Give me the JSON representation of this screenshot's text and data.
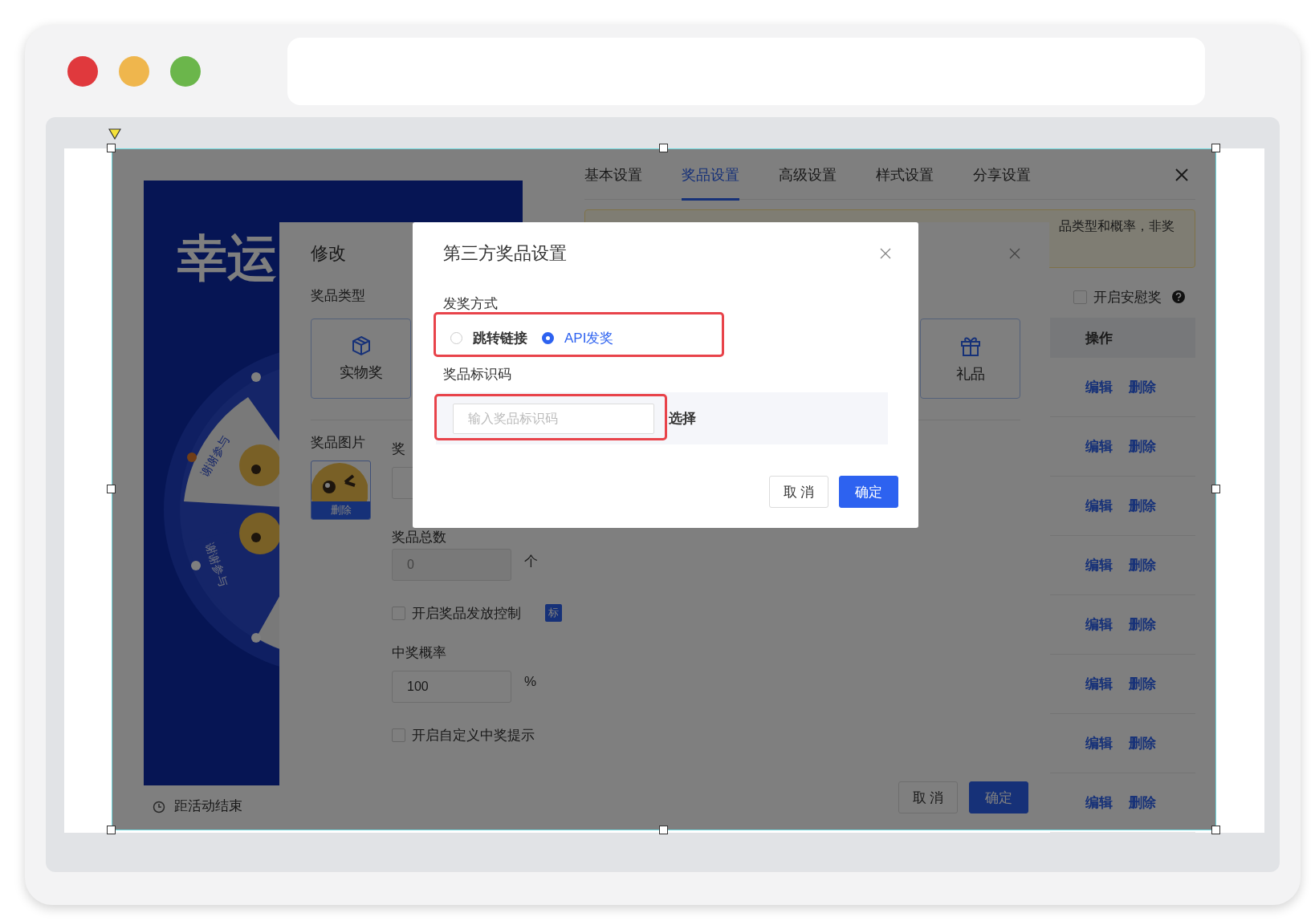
{
  "poster": {
    "title": "幸运",
    "wheel_labels": [
      "谢谢参与",
      "谢谢参与"
    ],
    "countdown": "距活动结束"
  },
  "tabs": [
    {
      "label": "基本设置",
      "selected": false
    },
    {
      "label": "奖品设置",
      "selected": true
    },
    {
      "label": "高级设置",
      "selected": false
    },
    {
      "label": "样式设置",
      "selected": false
    },
    {
      "label": "分享设置",
      "selected": false
    }
  ],
  "notice": "品类型和概率，非奖",
  "consolation": {
    "label": "开启安慰奖",
    "checked": false
  },
  "table": {
    "columns": [
      "操作"
    ],
    "rows": [
      {
        "actions": [
          "编辑",
          "删除"
        ]
      },
      {
        "actions": [
          "编辑",
          "删除"
        ]
      },
      {
        "actions": [
          "编辑",
          "删除"
        ]
      },
      {
        "actions": [
          "编辑",
          "删除"
        ]
      },
      {
        "actions": [
          "编辑",
          "删除"
        ]
      },
      {
        "actions": [
          "编辑",
          "删除"
        ]
      },
      {
        "actions": [
          "编辑",
          "删除"
        ]
      },
      {
        "actions": [
          "编辑",
          "删除"
        ]
      }
    ]
  },
  "edit_dialog": {
    "title": "修改",
    "prize_type_label": "奖品类型",
    "prize_types": [
      {
        "label": "实物奖",
        "kind": "box"
      },
      {
        "label": "礼品",
        "kind": "gift"
      }
    ],
    "image_label": "奖品图片",
    "image_delete": "删除",
    "name_label": "奖",
    "total_label": "奖品总数",
    "total_value": "0",
    "total_unit": "个",
    "release_control": {
      "label": "开启奖品发放控制",
      "checked": false
    },
    "tag": "标",
    "probability_label": "中奖概率",
    "probability_value": "100",
    "probability_unit": "%",
    "custom_tip": {
      "label": "开启自定义中奖提示",
      "checked": false
    },
    "buttons": [
      {
        "label": "取 消",
        "kind": "default"
      },
      {
        "label": "确定",
        "kind": "primary"
      }
    ]
  },
  "prize_dialog": {
    "title": "第三方奖品设置",
    "method_label": "发奖方式",
    "methods": [
      {
        "label": "跳转链接",
        "selected": false
      },
      {
        "label": "API发奖",
        "selected": true
      }
    ],
    "code_label": "奖品标识码",
    "code_placeholder": "输入奖品标识码",
    "select_label": "选择",
    "buttons": [
      {
        "label": "取 消",
        "kind": "default"
      },
      {
        "label": "确定",
        "kind": "primary"
      }
    ]
  }
}
